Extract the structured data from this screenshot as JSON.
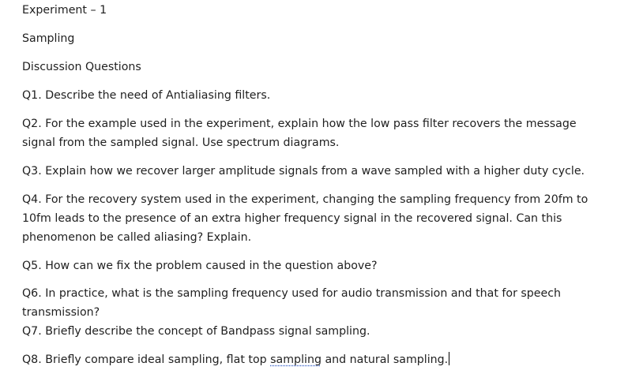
{
  "document": {
    "title": "Experiment – 1",
    "subtitle": "Sampling",
    "section": "Discussion Questions",
    "q1": "Q1. Describe the need of Antialiasing filters.",
    "q2_line1": "Q2. For the example used in the experiment, explain how the low pass filter recovers the message",
    "q2_line2": "signal from the sampled signal. Use spectrum diagrams.",
    "q3": "Q3. Explain how we recover larger amplitude signals from a wave sampled with a higher duty cycle.",
    "q4_line1": "Q4. For the recovery system used in the experiment, changing the sampling frequency from 20fm to",
    "q4_line2": "10fm leads to the presence of an extra higher frequency signal in the recovered signal. Can this",
    "q4_line3": "phenomenon be called aliasing? Explain.",
    "q5": "Q5. How can we fix the problem caused in the question above?",
    "q6_line1": "Q6. In practice, what is the sampling frequency used for audio transmission and that for speech",
    "q6_line2": "transmission?",
    "q7": "Q7. Briefly describe the concept of Bandpass signal sampling.",
    "q8_part1": "Q8. Briefly compare ideal sampling, flat top ",
    "q8_spell": "sampling",
    "q8_part2": " and natural sampling."
  }
}
